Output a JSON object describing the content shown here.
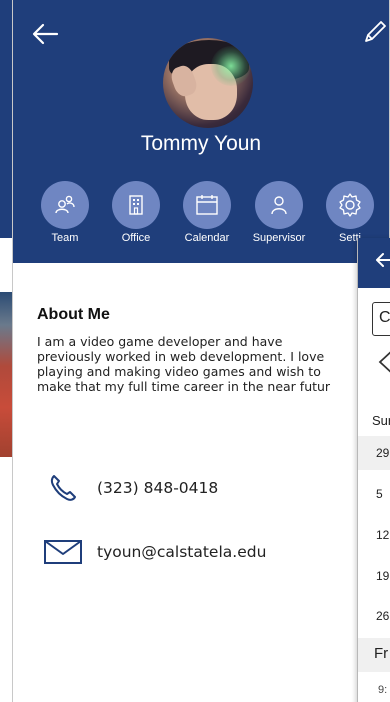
{
  "profile": {
    "name": "Tommy Youn"
  },
  "quick_actions": [
    {
      "label": "Team",
      "icon": "team-icon"
    },
    {
      "label": "Office",
      "icon": "office-building-icon"
    },
    {
      "label": "Calendar",
      "icon": "calendar-icon"
    },
    {
      "label": "Supervisor",
      "icon": "person-icon"
    },
    {
      "label": "Setti",
      "icon": "gear-icon"
    }
  ],
  "about": {
    "title": "About Me",
    "lines": [
      "I am a video game developer and have",
      "previously worked in web development. I love",
      "playing and making video games and wish to",
      "make that my full time career in the near futur"
    ]
  },
  "contact": {
    "phone": "(323) 848-0418",
    "email": "tyoun@calstatela.edu"
  },
  "calendar_peek": {
    "field_text": "C",
    "day_of_week": "Sur",
    "days": [
      "29",
      "5",
      "12",
      "19",
      "26"
    ],
    "section_label": "Fr",
    "time": "9:"
  },
  "colors": {
    "header": "#1f3e7b",
    "action_circle": "#6f86c2",
    "icon_stroke": "#1f3e7b"
  }
}
